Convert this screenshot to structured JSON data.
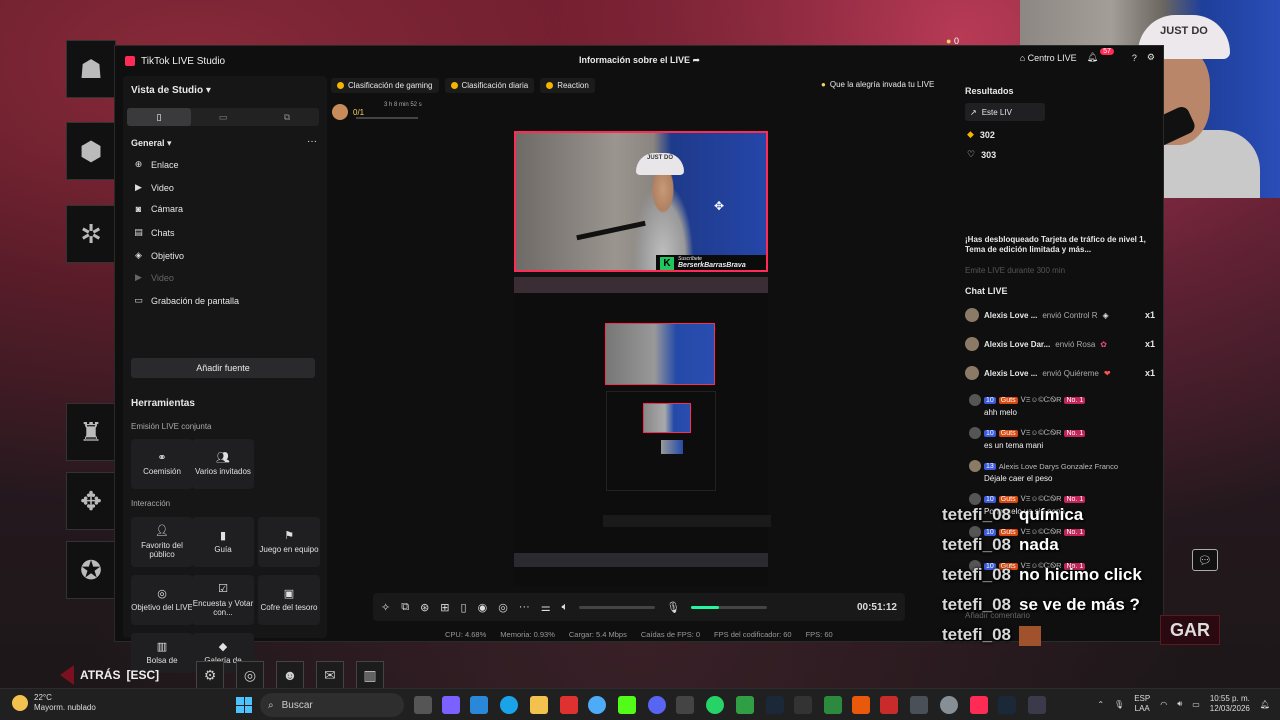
{
  "studio": {
    "title": "TikTok LIVE Studio",
    "center_title": "Información sobre el LIVE",
    "centro_live": "Centro LIVE",
    "notif_count": "57"
  },
  "sidebar": {
    "title": "Vista de Studio",
    "general": "General",
    "sources": [
      {
        "icon": "link-icon",
        "label": "Enlace"
      },
      {
        "icon": "video-icon",
        "label": "Video"
      },
      {
        "icon": "camera-icon",
        "label": "Cámara"
      },
      {
        "icon": "chat-icon",
        "label": "Chats"
      },
      {
        "icon": "target-icon",
        "label": "Objetivo"
      },
      {
        "icon": "video-icon",
        "label": "Video"
      },
      {
        "icon": "screen-icon",
        "label": "Grabación de pantalla"
      }
    ],
    "add_source": "Añadir fuente",
    "tools_title": "Herramientas",
    "joint_title": "Emisión LIVE conjunta",
    "joint_tools": [
      "Coemisión",
      "Varios invitados"
    ],
    "interaction_title": "Interacción",
    "interaction_tools": [
      "Favorito del público",
      "Guía",
      "Juego en equipo",
      "Objetivo del LIVE",
      "Encuesta y Votar con...",
      "Cofre del tesoro",
      "Bolsa de",
      "Galería de"
    ]
  },
  "chips": {
    "items": [
      "Clasificación de gaming",
      "Clasificación diaria",
      "Reaction"
    ],
    "right": "Que la alegría invada tu LIVE"
  },
  "goal": {
    "count": "0/1",
    "time": "3 h 8 min 52 s"
  },
  "preview": {
    "cap_text": "JUST DO",
    "banner_label": "Suscríbete",
    "banner_name": "BerserkBarrasBrava"
  },
  "controls": {
    "timer": "00:51:12",
    "mic_level": 0.37
  },
  "stats": [
    "CPU: 4.68%",
    "Memoria: 0.93%",
    "Cargar: 5.4 Mbps",
    "Caídas de FPS: 0",
    "FPS del codificador: 60",
    "FPS: 60"
  ],
  "right_panel": {
    "results_title": "Resultados",
    "tab_label": "Este LIV",
    "diamonds": "302",
    "likes": "303",
    "unlock_text": "¡Has desbloqueado Tarjeta de tráfico de nivel 1, Tema de edición limitada y más...",
    "unlock_sub": "Emite LIVE durante 300 min",
    "chat_title": "Chat LIVE",
    "gifts": [
      {
        "name": "Alexis Love ...",
        "action": "envió Control R",
        "qty": "x1"
      },
      {
        "name": "Alexis Love Dar...",
        "action": "envió Rosa",
        "qty": "x1"
      },
      {
        "name": "Alexis Love ...",
        "action": "envió Quiéreme",
        "qty": "x1"
      }
    ],
    "messages": [
      {
        "level": "10",
        "fan": "Guts",
        "user": "ᐯΞ☺©ᏨᏫR",
        "rank": "No. 1",
        "text": "ahh melo"
      },
      {
        "level": "10",
        "fan": "Guts",
        "user": "ᐯΞ☺©ᏨᏫR",
        "rank": "No. 1",
        "text": "es un tema mani"
      },
      {
        "level": "13",
        "fan": "",
        "user": "Alexis Love Darys Gonzalez Franco",
        "rank": "",
        "text": "Déjale caer el peso"
      },
      {
        "level": "10",
        "fan": "Guts",
        "user": "ᐯΞ☺©ᏨᏫR",
        "rank": "No. 1",
        "text": "Pongaselo ya sin pena"
      },
      {
        "level": "10",
        "fan": "Guts",
        "user": "ᐯΞ☺©ᏨᏫR",
        "rank": "No. 1",
        "text": ""
      },
      {
        "level": "10",
        "fan": "Guts",
        "user": "ᐯΞ☺©ᏨᏫR",
        "rank": "No. 1",
        "text": ""
      }
    ],
    "comment_placeholder": "Añadir comentario"
  },
  "overlay_chat": [
    {
      "user": "tetefi_08",
      "text": "química"
    },
    {
      "user": "tetefi_08",
      "text": "nada"
    },
    {
      "user": "tetefi_08",
      "text": "no hicimo click"
    },
    {
      "user": "tetefi_08",
      "text": "se ve de más ?"
    },
    {
      "user": "tetefi_08",
      "text": ""
    }
  ],
  "game": {
    "back_label": "ATRÁS",
    "back_key": "[ESC]",
    "play_label": "GAR",
    "coin_count": "0"
  },
  "taskbar": {
    "temp": "22°C",
    "weather": "Mayorm. nublado",
    "search": "Buscar",
    "lang1": "ESP",
    "lang2": "LAA",
    "time": "10:55 p. m.",
    "date": "12/03/2026"
  }
}
